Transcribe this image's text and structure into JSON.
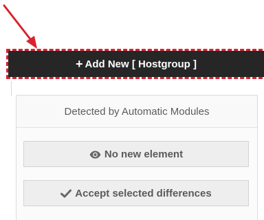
{
  "add_button": {
    "plus_glyph": "+",
    "label": "Add New [ Hostgroup ]"
  },
  "panel": {
    "header": "Detected by Automatic Modules",
    "no_new_label": "No new element",
    "accept_label": "Accept selected differences"
  },
  "icons": {
    "plus": "plus-icon",
    "eye": "eye-icon",
    "check": "check-icon",
    "arrow": "annotation-arrow"
  },
  "colors": {
    "annotation_red": "#d9232e",
    "button_dark": "#262626",
    "panel_button_bg": "#eeeeee",
    "text_grey": "#5a5a5a"
  }
}
